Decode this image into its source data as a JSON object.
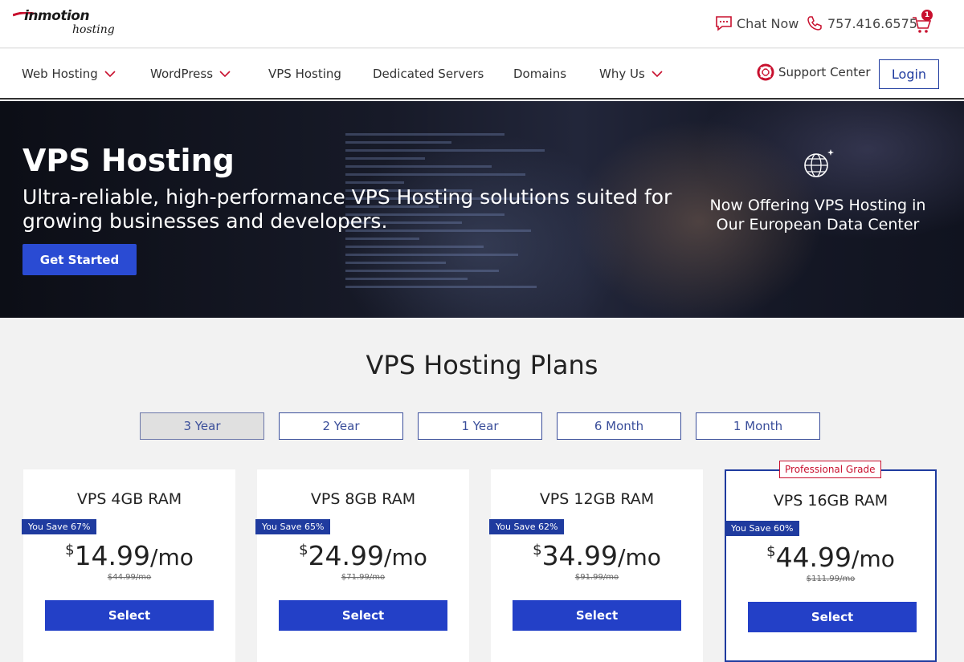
{
  "header": {
    "logo_text": "inmotion",
    "logo_sub": "hosting",
    "chat_label": "Chat Now",
    "phone": "757.416.6575",
    "cart_count": "1"
  },
  "nav": {
    "items": [
      {
        "label": "Web Hosting",
        "dropdown": true
      },
      {
        "label": "WordPress",
        "dropdown": true
      },
      {
        "label": "VPS Hosting",
        "dropdown": false
      },
      {
        "label": "Dedicated Servers",
        "dropdown": false
      },
      {
        "label": "Domains",
        "dropdown": false
      },
      {
        "label": "Why Us",
        "dropdown": true
      }
    ],
    "support_label": "Support Center",
    "login_label": "Login"
  },
  "hero": {
    "title": "VPS Hosting",
    "subtitle": "Ultra-reliable, high-performance VPS Hosting solutions suited for growing businesses and developers.",
    "cta_label": "Get Started",
    "side_text": "Now Offering VPS Hosting in Our European Data Center"
  },
  "plans": {
    "title": "VPS Hosting Plans",
    "terms": [
      "3 Year",
      "2 Year",
      "1 Year",
      "6 Month",
      "1 Month"
    ],
    "active_term": "3 Year",
    "cards": [
      {
        "name": "VPS 4GB RAM",
        "save": "You Save 67%",
        "currency": "$",
        "price": "14.99",
        "per": "/mo",
        "was": "44.99/mo",
        "button": "Select"
      },
      {
        "name": "VPS 8GB RAM",
        "save": "You Save 65%",
        "currency": "$",
        "price": "24.99",
        "per": "/mo",
        "was": "71.99/mo",
        "button": "Select"
      },
      {
        "name": "VPS 12GB RAM",
        "save": "You Save 62%",
        "currency": "$",
        "price": "34.99",
        "per": "/mo",
        "was": "91.99/mo",
        "button": "Select"
      },
      {
        "name": "VPS 16GB RAM",
        "save": "You Save 60%",
        "currency": "$",
        "price": "44.99",
        "per": "/mo",
        "was": "111.99/mo",
        "button": "Select",
        "badge": "Professional Grade"
      }
    ]
  },
  "colors": {
    "brand_red": "#c8102e",
    "brand_blue": "#2340c7",
    "navy": "#1f3b9f"
  }
}
